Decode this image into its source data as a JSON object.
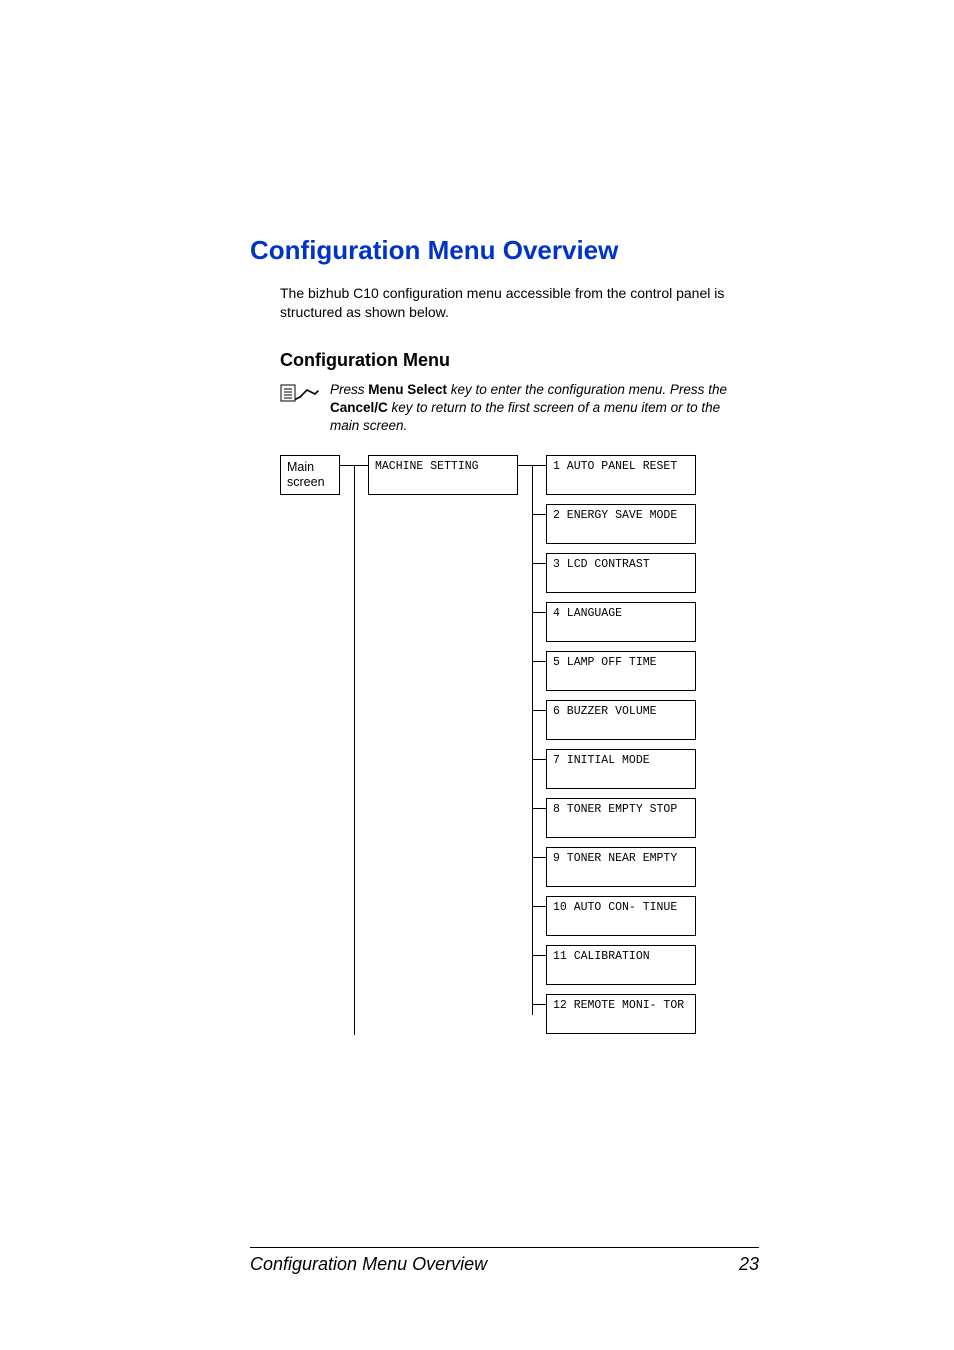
{
  "heading": "Configuration Menu Overview",
  "intro": "The bizhub C10 configuration menu accessible from the control panel is structured as shown below.",
  "subheading": "Configuration Menu",
  "note": {
    "part1": "Press ",
    "bold1": "Menu Select",
    "part2": " key to enter the configuration menu. Press the ",
    "bold2": "Cancel/C",
    "part3": " key to return to the first screen of a menu item or to the main screen."
  },
  "diagram": {
    "main": "Main screen",
    "machine": "MACHINE SETTING",
    "items": [
      "1 AUTO PANEL RESET",
      "2 ENERGY SAVE MODE",
      "3 LCD CONTRAST",
      "4 LANGUAGE",
      "5 LAMP OFF TIME",
      "6 BUZZER VOLUME",
      "7 INITIAL MODE",
      "8 TONER EMPTY STOP",
      "9 TONER NEAR EMPTY",
      "10 AUTO CON- TINUE",
      "11 CALIBRATION",
      "12 REMOTE MONI- TOR"
    ]
  },
  "footer_title": "Configuration Menu Overview",
  "page_number": "23"
}
